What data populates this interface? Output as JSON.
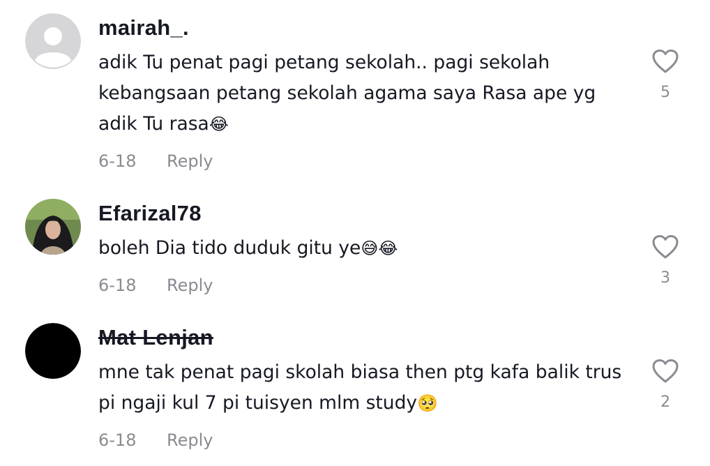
{
  "comments": [
    {
      "username": "mairah_.",
      "text": "adik Tu penat pagi petang sekolah.. pagi sekolah kebangsaan petang sekolah agama saya Rasa ape yg adik Tu rasa",
      "emojis": "😂",
      "date": "6-18",
      "reply_label": "Reply",
      "likes": "5",
      "avatar": "default-avatar-icon"
    },
    {
      "username": "Efarizal78",
      "text": "boleh Dia tido duduk gitu ye",
      "emojis": "😅😂",
      "date": "6-18",
      "reply_label": "Reply",
      "likes": "3",
      "avatar": "profile-photo"
    },
    {
      "username": "Mat Lenjan",
      "text": "mne tak penat pagi skolah biasa then ptg kafa balik trus pi ngaji kul 7 pi tuisyen mlm study",
      "emojis": "🥺",
      "date": "6-18",
      "reply_label": "Reply",
      "likes": "2",
      "avatar": "black-avatar"
    }
  ],
  "colors": {
    "text": "#161823",
    "secondary": "#8a8b91",
    "heart_outline": "#8a8b91"
  }
}
